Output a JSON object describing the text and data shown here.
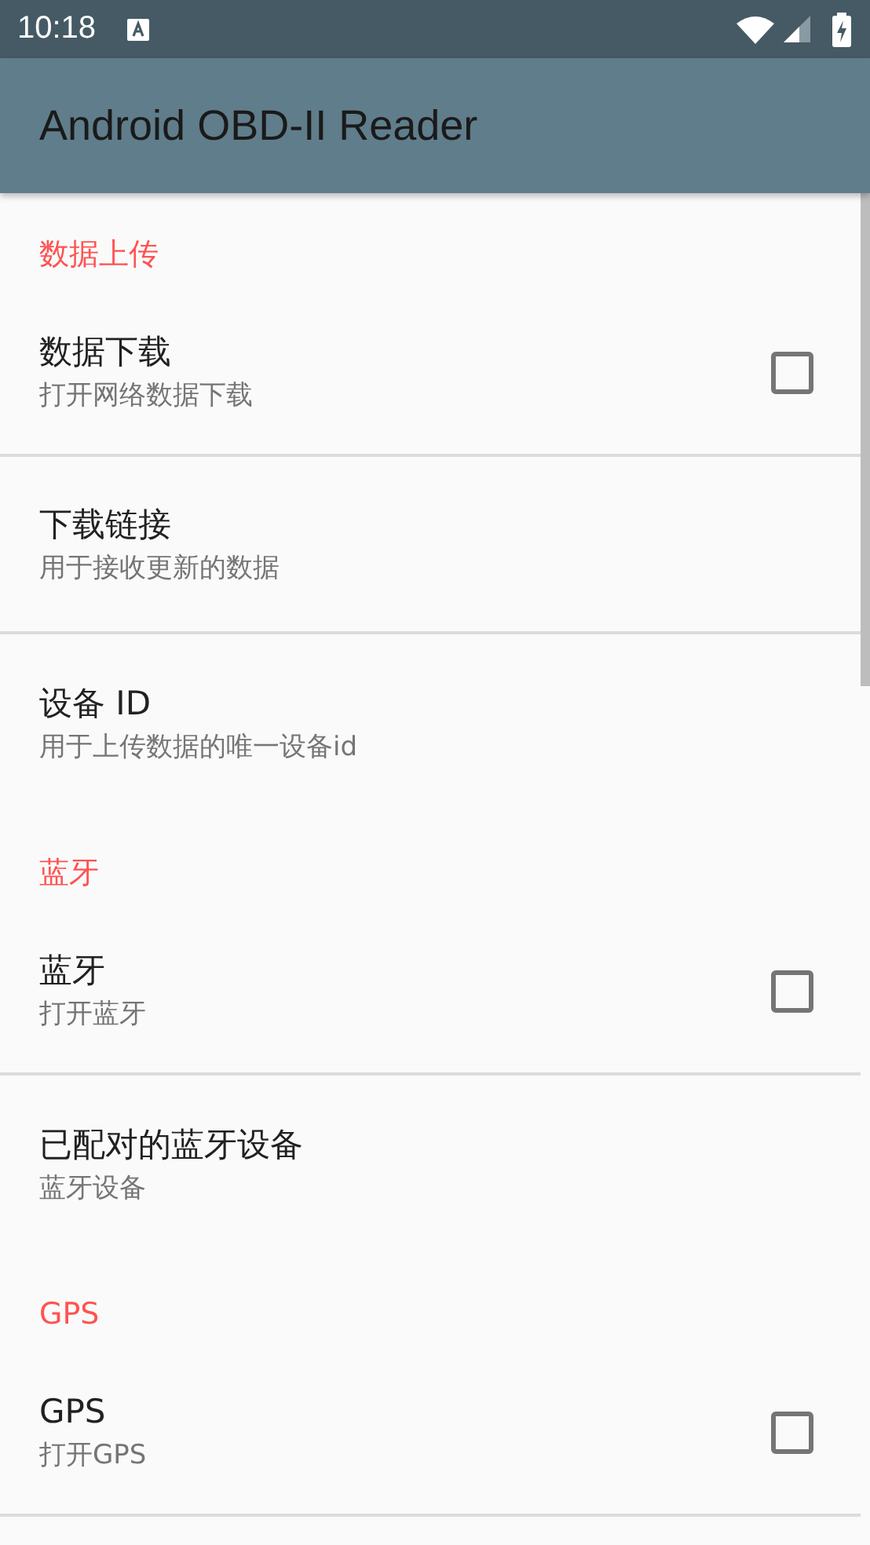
{
  "status_bar": {
    "time": "10:18"
  },
  "app_bar": {
    "title": "Android OBD-II Reader"
  },
  "sections": [
    {
      "title": "数据上传",
      "items": [
        {
          "kind": "checkbox",
          "title": "数据下载",
          "summary": "打开网络数据下载",
          "checked": false
        },
        {
          "kind": "plain",
          "title": "下载链接",
          "summary": "用于接收更新的数据"
        },
        {
          "kind": "plain",
          "title": "设备 ID",
          "summary": "用于上传数据的唯一设备id"
        }
      ]
    },
    {
      "title": "蓝牙",
      "items": [
        {
          "kind": "checkbox",
          "title": "蓝牙",
          "summary": "打开蓝牙",
          "checked": false
        },
        {
          "kind": "plain",
          "title": "已配对的蓝牙设备",
          "summary": "蓝牙设备"
        }
      ]
    },
    {
      "title": "GPS",
      "items": [
        {
          "kind": "checkbox",
          "title": "GPS",
          "summary": "打开GPS",
          "checked": false
        }
      ]
    }
  ]
}
